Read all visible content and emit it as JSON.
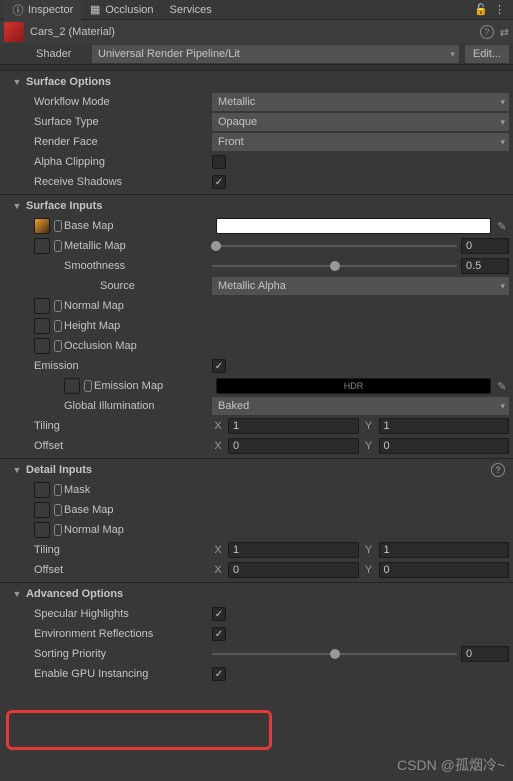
{
  "tabs": {
    "inspector": "Inspector",
    "occlusion": "Occlusion",
    "services": "Services"
  },
  "header": {
    "title": "Cars_2 (Material)",
    "shader_label": "Shader",
    "shader_value": "Universal Render Pipeline/Lit",
    "edit": "Edit..."
  },
  "surface_options": {
    "title": "Surface Options",
    "workflow_mode": {
      "label": "Workflow Mode",
      "value": "Metallic"
    },
    "surface_type": {
      "label": "Surface Type",
      "value": "Opaque"
    },
    "render_face": {
      "label": "Render Face",
      "value": "Front"
    },
    "alpha_clipping": {
      "label": "Alpha Clipping",
      "checked": false
    },
    "receive_shadows": {
      "label": "Receive Shadows",
      "checked": true
    }
  },
  "surface_inputs": {
    "title": "Surface Inputs",
    "base_map": "Base Map",
    "metallic_map": "Metallic Map",
    "metallic_value": "0",
    "smoothness": {
      "label": "Smoothness",
      "value": "0.5"
    },
    "source": {
      "label": "Source",
      "value": "Metallic Alpha"
    },
    "normal_map": "Normal Map",
    "height_map": "Height Map",
    "occlusion_map": "Occlusion Map",
    "emission": {
      "label": "Emission",
      "checked": true
    },
    "emission_map": "Emission Map",
    "emission_hdr": "HDR",
    "global_illumination": {
      "label": "Global Illumination",
      "value": "Baked"
    },
    "tiling": {
      "label": "Tiling",
      "x": "1",
      "y": "1"
    },
    "offset": {
      "label": "Offset",
      "x": "0",
      "y": "0"
    }
  },
  "detail_inputs": {
    "title": "Detail Inputs",
    "mask": "Mask",
    "base_map": "Base Map",
    "normal_map": "Normal Map",
    "tiling": {
      "label": "Tiling",
      "x": "1",
      "y": "1"
    },
    "offset": {
      "label": "Offset",
      "x": "0",
      "y": "0"
    }
  },
  "advanced": {
    "title": "Advanced Options",
    "specular_highlights": {
      "label": "Specular Highlights",
      "checked": true
    },
    "environment_reflections": {
      "label": "Environment Reflections",
      "checked": true
    },
    "sorting_priority": {
      "label": "Sorting Priority",
      "value": "0"
    },
    "enable_gpu_instancing": {
      "label": "Enable GPU Instancing",
      "checked": true
    }
  },
  "watermark": "CSDN @孤烟冷~"
}
